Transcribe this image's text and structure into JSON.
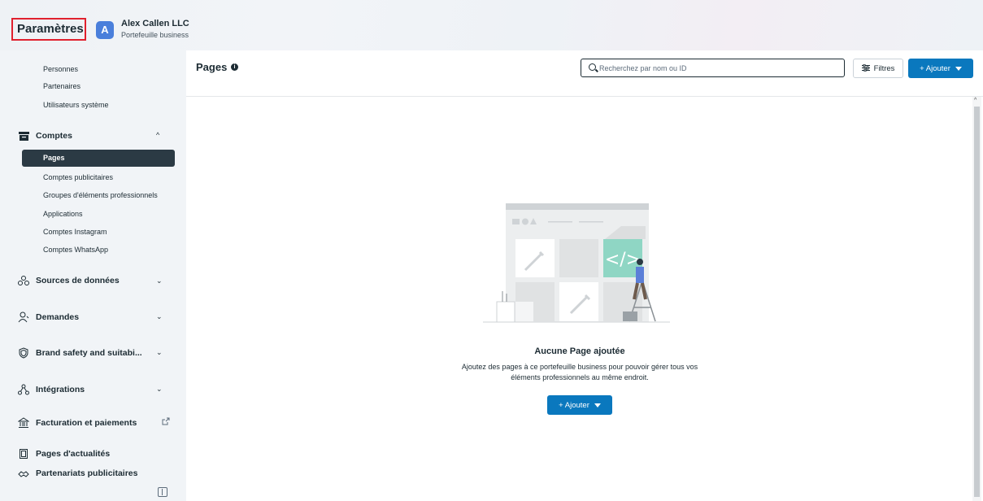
{
  "header": {
    "title": "Paramètres",
    "avatar_letter": "A",
    "business_name": "Alex Callen LLC",
    "business_type": "Portefeuille business"
  },
  "sidebar": {
    "people_items": [
      "Personnes",
      "Partenaires",
      "Utilisateurs système"
    ],
    "accounts_section": "Comptes",
    "accounts_items": [
      "Pages",
      "Comptes publicitaires",
      "Groupes d'éléments professionnels",
      "Applications",
      "Comptes Instagram",
      "Comptes WhatsApp"
    ],
    "active_item": "Pages",
    "sections": [
      "Sources de données",
      "Demandes",
      "Brand safety and suitabi...",
      "Intégrations",
      "Facturation et paiements",
      "Pages d'actualités",
      "Partenariats publicitaires"
    ]
  },
  "main": {
    "title": "Pages",
    "search_placeholder": "Recherchez par nom ou ID",
    "filters_label": "Filtres",
    "add_label": "+ Ajouter",
    "empty_title": "Aucune Page ajoutée",
    "empty_description": "Ajoutez des pages à ce portefeuille business pour pouvoir gérer tous vos éléments professionnels au même endroit.",
    "empty_add_label": "+ Ajouter"
  },
  "colors": {
    "accent": "#0a78be",
    "active_bg": "#2b3a44",
    "highlight_border": "#e0212e",
    "illustration_teal": "#8fd6c4"
  }
}
